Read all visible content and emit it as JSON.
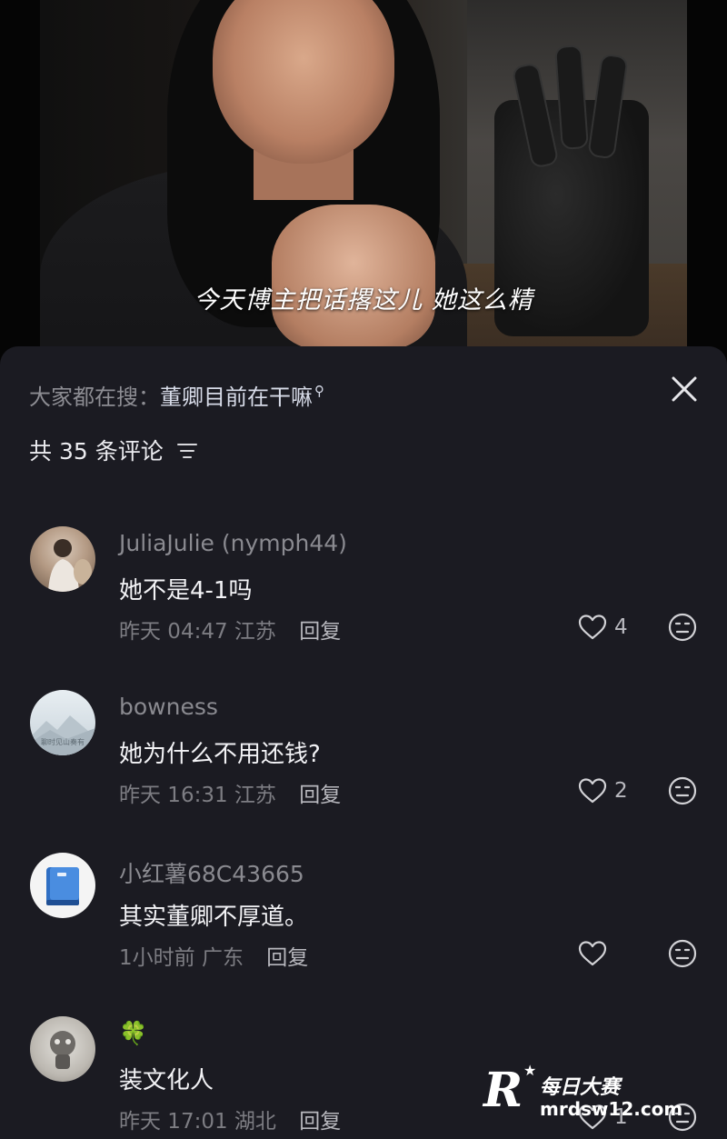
{
  "video": {
    "subtitle": "今天博主把话撂这儿 她这么精"
  },
  "comments_panel": {
    "hot_search_prefix": "大家都在搜：",
    "hot_search_term": "董卿目前在干嘛",
    "count_label": "共 35 条评论",
    "icons": {
      "close": "close-icon",
      "sort": "sort-icon",
      "search": "search-icon",
      "like": "heart-icon",
      "dislike": "dislike-face-icon"
    }
  },
  "comments": [
    {
      "username": "JuliaJulie (nymph44)",
      "text": "她不是4-1吗",
      "time": "昨天 04:47",
      "location": "江苏",
      "reply_label": "回复",
      "likes": "4"
    },
    {
      "username": "bowness",
      "avatar_text": "聊时见山奏有",
      "text": "她为什么不用还钱?",
      "time": "昨天 16:31",
      "location": "江苏",
      "reply_label": "回复",
      "likes": "2"
    },
    {
      "username": "小红薯68C43665",
      "text": "其实董卿不厚道。",
      "time": "1小时前",
      "location": "广东",
      "reply_label": "回复",
      "likes": ""
    },
    {
      "username": "🍀",
      "text": "装文化人",
      "time": "昨天 17:01",
      "location": "湖北",
      "reply_label": "回复",
      "likes": "1"
    }
  ],
  "watermark": {
    "logo_letter": "R",
    "name": "每日大赛",
    "url": "mrdsw12.com"
  }
}
